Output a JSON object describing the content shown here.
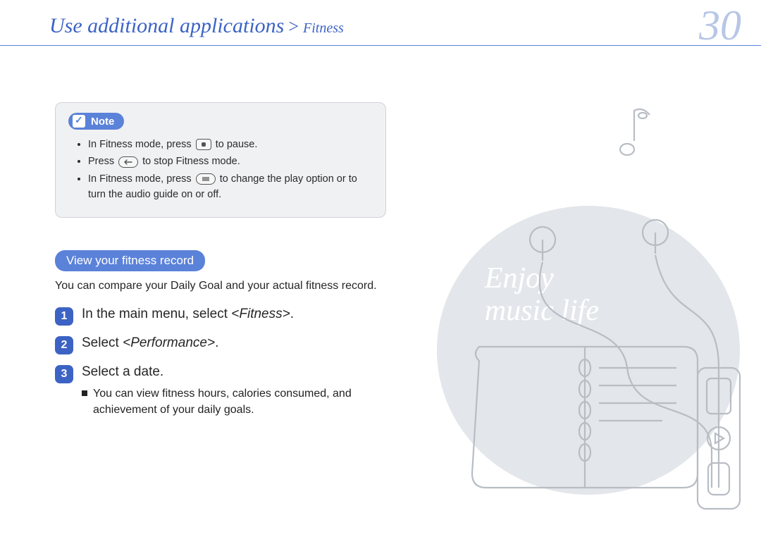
{
  "header": {
    "breadcrumb_main": "Use additional applications",
    "breadcrumb_sep": ">",
    "breadcrumb_sub": "Fitness"
  },
  "page_number": "30",
  "note": {
    "badge": "Note",
    "items": [
      {
        "pre": "In Fitness mode, press ",
        "icon": "square-button",
        "post": " to pause."
      },
      {
        "pre": "Press ",
        "icon": "back-button",
        "post": " to stop Fitness mode."
      },
      {
        "pre": "In Fitness mode, press ",
        "icon": "menu-button",
        "post": " to change the play option or to turn the audio guide on or off."
      }
    ]
  },
  "section": {
    "pill": "View your fitness record",
    "intro": "You can compare your Daily Goal and your actual fitness record."
  },
  "steps": [
    {
      "n": "1",
      "pre": "In the main menu, select ",
      "em": "<Fitness>",
      "post": "."
    },
    {
      "n": "2",
      "pre": "Select ",
      "em": "<Performance>",
      "post": "."
    },
    {
      "n": "3",
      "pre": "Select a date.",
      "em": "",
      "post": "",
      "sub": "You can view fitness hours, calories consumed, and achievement of your daily goals."
    }
  ],
  "illustration_caption_line1": "Enjoy",
  "illustration_caption_line2": "music life"
}
